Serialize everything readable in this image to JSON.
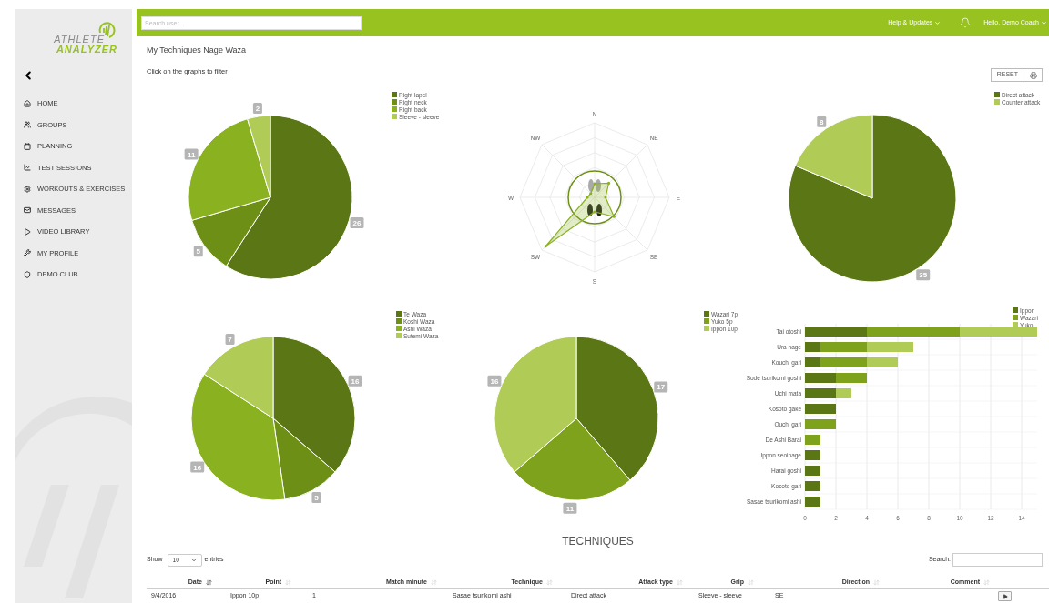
{
  "logo": {
    "line_1": "ATHLETE",
    "line_2": "ANALYZER"
  },
  "sidebar": {
    "items": [
      {
        "label": "HOME"
      },
      {
        "label": "GROUPS"
      },
      {
        "label": "PLANNING"
      },
      {
        "label": "TEST SESSIONS"
      },
      {
        "label": "WORKOUTS & EXERCISES"
      },
      {
        "label": "MESSAGES"
      },
      {
        "label": "VIDEO LIBRARY"
      },
      {
        "label": "MY PROFILE"
      },
      {
        "label": "DEMO CLUB"
      }
    ]
  },
  "top_bar": {
    "search": {
      "placeholder": "Search user..."
    },
    "help_menu": "Help & Updates",
    "user_menu": "Hello, Demo Coach"
  },
  "page": {
    "title": "My Techniques Nage Waza",
    "hint": "Click on the graphs to filter",
    "reset_button": "RESET"
  },
  "grip_chart": {
    "chart_data": {
      "type": "pie",
      "categories": [
        "Right lapel",
        "Right neck",
        "Right back",
        "Sleeve - sleeve"
      ],
      "values": [
        26,
        5,
        11,
        2
      ],
      "data_labels": true,
      "legend": "top-right"
    }
  },
  "direction_chart": {
    "directions": [
      "N",
      "NE",
      "E",
      "SE",
      "S",
      "SW",
      "W",
      "NW"
    ]
  },
  "attack_chart": {
    "chart_data": {
      "type": "pie",
      "categories": [
        "Direct attack",
        "Counter attack"
      ],
      "values": [
        35,
        8
      ],
      "data_labels": true,
      "legend": "top-right"
    }
  },
  "group_chart": {
    "chart_data": {
      "type": "pie",
      "categories": [
        "Te Waza",
        "Koshi Waza",
        "Ashi Waza",
        "Sutemi Waza"
      ],
      "values": [
        16,
        5,
        16,
        7
      ],
      "data_labels": true,
      "legend": "top-right"
    }
  },
  "score_chart": {
    "chart_data": {
      "type": "pie",
      "categories": [
        "Wazari 7p",
        "Yuko 5p",
        "Ippon 10p"
      ],
      "values": [
        17,
        11,
        16
      ],
      "data_labels": true,
      "legend": "top-right"
    }
  },
  "technique_chart": {
    "chart_data": {
      "type": "bar",
      "orientation": "horizontal",
      "stacked": true,
      "categories": [
        "Tai otoshi",
        "Ura nage",
        "Kouchi gari",
        "Sode tsurikomi goshi",
        "Uchi mata",
        "Kosoto gake",
        "Ouchi gari",
        "De Ashi Barai",
        "Ippon seoinage",
        "Harai goshi",
        "Kosoto gari",
        "Sasae tsurikomi ashi"
      ],
      "series": [
        {
          "name": "Ippon",
          "color": "#5b7614",
          "values": [
            4,
            1,
            1,
            2,
            2,
            2,
            0,
            0,
            1,
            1,
            1,
            1
          ]
        },
        {
          "name": "Wazari",
          "color": "#7fa21c",
          "values": [
            6,
            3,
            3,
            2,
            0,
            0,
            2,
            1,
            0,
            0,
            0,
            0
          ]
        },
        {
          "name": "Yuko",
          "color": "#b0cb56",
          "values": [
            5,
            3,
            2,
            0,
            1,
            0,
            0,
            0,
            0,
            0,
            0,
            0
          ]
        }
      ],
      "xlim": [
        0,
        15
      ],
      "xticks": [
        0,
        2,
        4,
        6,
        8,
        10,
        12,
        14
      ],
      "grid": true,
      "legend": "top-right"
    }
  },
  "table_section": {
    "title": "TECHNIQUES",
    "length_label_before": "Show",
    "length_value": "10",
    "length_label_after": "entries",
    "search_label": "Search:",
    "columns": [
      {
        "label": "Date",
        "sorted": true
      },
      {
        "label": "Point",
        "sorted": false
      },
      {
        "label": "Match minute",
        "sorted": false
      },
      {
        "label": "Technique",
        "sorted": false
      },
      {
        "label": "Attack type",
        "sorted": false
      },
      {
        "label": "Grip",
        "sorted": false
      },
      {
        "label": "Direction",
        "sorted": false
      },
      {
        "label": "Comment",
        "sorted": false
      }
    ],
    "rows": [
      {
        "cells": [
          "9/4/2016",
          "Ippon 10p",
          "1",
          "Sasae tsurikomi ashi",
          "Direct attack",
          "Sleeve - sleeve",
          "SE"
        ]
      }
    ]
  }
}
